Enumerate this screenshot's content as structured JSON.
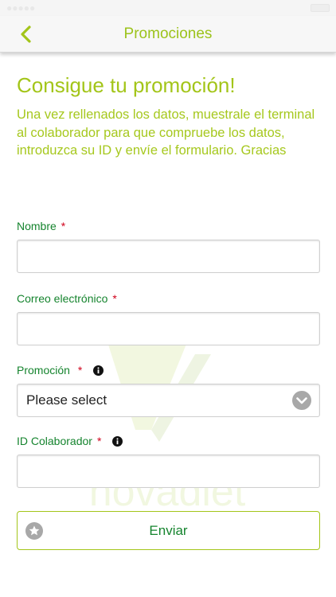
{
  "nav": {
    "title": "Promociones",
    "back_icon": "chevron-left-icon"
  },
  "form": {
    "heading": "Consigue tu promoción!",
    "intro": "Una vez rellenados los datos, muestrale el terminal al colaborador para que compruebe los datos, introduzca su ID y envíe el formulario. Gracias",
    "required_marker": "*",
    "fields": {
      "name": {
        "label": "Nombre",
        "value": ""
      },
      "email": {
        "label": "Correo electrónico",
        "value": ""
      },
      "promotion": {
        "label": "Promoción",
        "selected": "Please select"
      },
      "partner_id": {
        "label": "ID Colaborador",
        "value": ""
      }
    },
    "submit_label": "Enviar"
  },
  "colors": {
    "accent": "#a3c519",
    "label_green": "#15842e",
    "required_red": "#d0021b"
  },
  "watermark": {
    "brand": "novadiet"
  }
}
